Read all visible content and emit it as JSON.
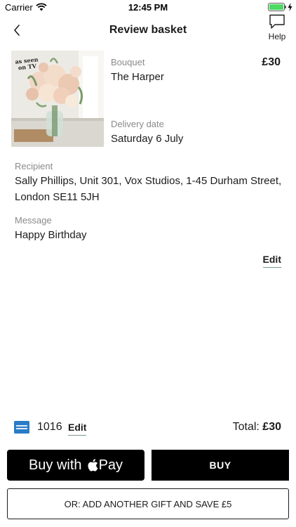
{
  "status_bar": {
    "carrier": "Carrier",
    "time": "12:45 PM",
    "battery_level": 1.0
  },
  "nav": {
    "title": "Review basket",
    "help_label": "Help"
  },
  "item": {
    "badge": [
      "as seen",
      "on TV"
    ],
    "bouquet_label": "Bouquet",
    "bouquet_name": "The Harper",
    "price": "£30",
    "delivery_label": "Delivery date",
    "delivery_date": "Saturday 6 July",
    "recipient_label": "Recipient",
    "recipient_line1": "Sally Phillips, Unit 301, Vox Studios, 1-45 Durham Street,",
    "recipient_line2": "London SE11 5JH",
    "message_label": "Message",
    "message": "Happy Birthday",
    "edit_label": "Edit"
  },
  "payment": {
    "card_last4": "1016",
    "edit_label": "Edit",
    "total_label": "Total:",
    "total_amount": "£30"
  },
  "actions": {
    "apple_pay_prefix": "Buy with",
    "apple_pay_suffix": "Pay",
    "buy_label": "BUY",
    "add_gift_label": "OR: ADD ANOTHER GIFT AND SAVE £5"
  },
  "colors": {
    "edit_underline": "#7a9a8c",
    "battery": "#4cd964",
    "card": "#2a7cc7"
  }
}
